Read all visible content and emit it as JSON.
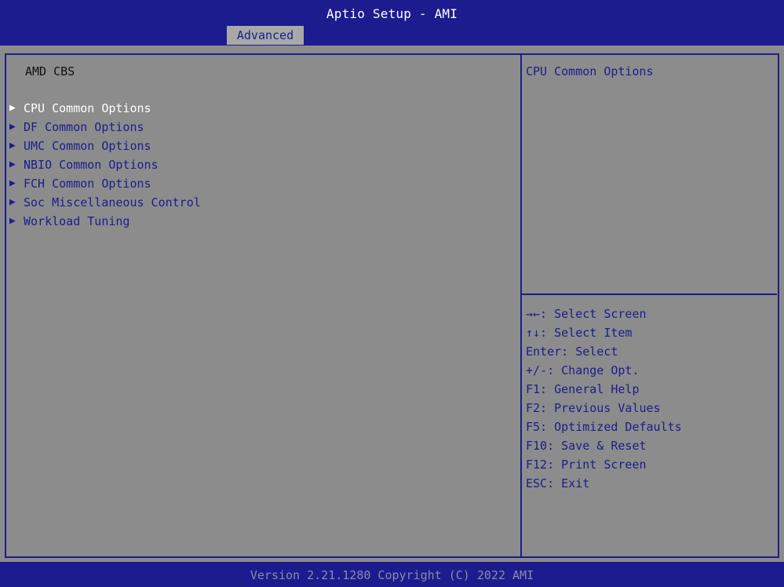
{
  "header": {
    "title": "Aptio Setup - AMI",
    "tab": "Advanced"
  },
  "main": {
    "section_title": "AMD CBS",
    "menu_arrow": "▶",
    "items": [
      {
        "label": "CPU Common Options"
      },
      {
        "label": "DF Common Options"
      },
      {
        "label": "UMC Common Options"
      },
      {
        "label": "NBIO Common Options"
      },
      {
        "label": "FCH Common Options"
      },
      {
        "label": "Soc Miscellaneous Control"
      },
      {
        "label": "Workload Tuning"
      }
    ],
    "selected_index": 0
  },
  "help_panel": {
    "description": "CPU Common Options",
    "keys": [
      "→←: Select Screen",
      "↑↓: Select Item",
      "Enter: Select",
      "+/-: Change Opt.",
      "F1: General Help",
      "F2: Previous Values",
      "F5: Optimized Defaults",
      "F10: Save & Reset",
      "F12: Print Screen",
      "ESC: Exit"
    ]
  },
  "footer": {
    "version": "Version 2.21.1280 Copyright (C) 2022 AMI"
  },
  "colors": {
    "header_bg": "#1c1c8e",
    "body_bg": "#8c8c8c",
    "text_blue": "#1c1c8e",
    "selected_text": "#ffffff"
  }
}
